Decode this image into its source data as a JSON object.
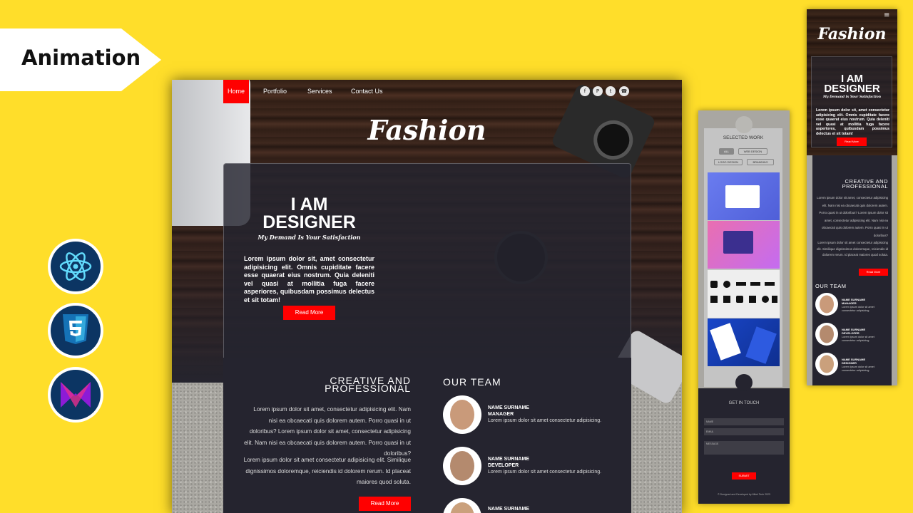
{
  "ribbon": {
    "label": "Animation"
  },
  "site": {
    "nav": [
      "Home",
      "Portfolio",
      "Services",
      "Contact Us"
    ],
    "logo": "Fashion",
    "hero": {
      "line1": "I AM",
      "line2": "DESIGNER",
      "tagline": "My Demand Is Your Satisfaction",
      "paragraph": "Lorem ipsum dolor sit, amet consectetur adipisicing elit. Omnis cupiditate facere esse quaerat eius nostrum. Quia deleniti vel quasi at mollitia fuga facere asperiores, quibusdam possimus delectus et sit totam!",
      "button": "Read More"
    },
    "creative": {
      "line1": "CREATIVE AND",
      "line2": "PROFESSIONAL",
      "p1": "Lorem ipsum dolor sit amet, consectetur adipisicing elit. Nam nisi ea obcaecati quis dolorem autem. Porro quasi in ut doloribus? Lorem ipsum dolor sit amet, consectetur adipisicing elit. Nam nisi ea obcaecati quis dolorem autem. Porro quasi in ut doloribus?",
      "p2": "Lorem ipsum dolor sit amet consectetur adipisicing elit. Similique dignissimos doloremque, reiciendis id dolorem rerum. Id placeat maiores quod soluta.",
      "button": "Read More"
    },
    "team": {
      "title": "OUR TEAM",
      "members": [
        {
          "name": "NAME SURNAME",
          "role": "MANAGER",
          "text": "Lorem ipsum dolor sit amet consectetur adipisicing."
        },
        {
          "name": "NAME SURNAME",
          "role": "DEVELOPER",
          "text": "Lorem ipsum dolor sit amet consectetur adipisicing."
        },
        {
          "name": "NAME SURNAME",
          "role": "DESIGNER",
          "text": "Lorem ipsum dolor sit amet consectetur adipisicing."
        }
      ]
    }
  },
  "tablet": {
    "work_title": "SELECTED WORK",
    "filters": [
      "ALL",
      "WEB DESIGN",
      "LOGO DESIGN",
      "BRANDING"
    ],
    "contact_title": "GET IN TOUCH",
    "fields": [
      "NAME",
      "EMAIL",
      "MESSAGE"
    ],
    "submit": "SUBMIT",
    "footer": "© Designed and Developed by Mikel Tech 2023"
  },
  "phone": {
    "menu_icon": "≡"
  },
  "colors": {
    "accent": "#ff0000",
    "background": "#ffde2a",
    "panel": "#25242f"
  },
  "icons": [
    "react-logo-icon",
    "css3-logo-icon",
    "m-logo-icon",
    "facebook-icon",
    "pinterest-icon",
    "twitter-icon",
    "phone-icon",
    "hamburger-menu-icon"
  ]
}
